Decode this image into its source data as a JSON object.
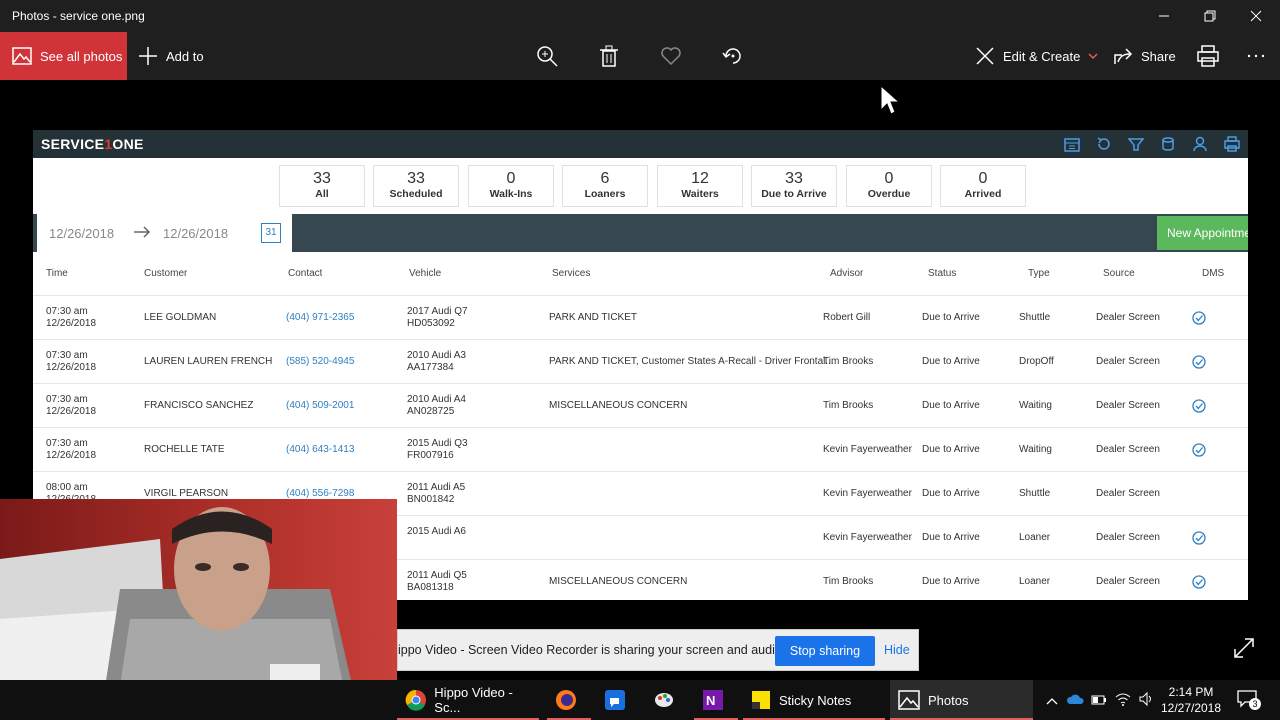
{
  "window": {
    "title": "Photos - service one.png"
  },
  "toolbar": {
    "see_all": "See all photos",
    "add_to": "Add to",
    "edit_create": "Edit & Create",
    "share": "Share"
  },
  "app": {
    "logo_a": "SERVICE",
    "logo_b": "1",
    "logo_c": "ONE",
    "stats": [
      {
        "num": "33",
        "label": "All"
      },
      {
        "num": "33",
        "label": "Scheduled"
      },
      {
        "num": "0",
        "label": "Walk-Ins"
      },
      {
        "num": "6",
        "label": "Loaners"
      },
      {
        "num": "12",
        "label": "Waiters"
      },
      {
        "num": "33",
        "label": "Due to Arrive"
      },
      {
        "num": "0",
        "label": "Overdue"
      },
      {
        "num": "0",
        "label": "Arrived"
      }
    ],
    "date_from": "12/26/2018",
    "date_to": "12/26/2018",
    "calendar_day": "31",
    "new_appt": "New Appointme",
    "columns": [
      "Time",
      "Customer",
      "Contact",
      "Vehicle",
      "Services",
      "Advisor",
      "Status",
      "Type",
      "Source",
      "DMS"
    ],
    "rows": [
      {
        "time": "07:30 am",
        "date": "12/26/2018",
        "customer": "LEE GOLDMAN",
        "contact": "(404) 971-2365",
        "vehicle": "2017 Audi Q7",
        "vin": "HD053092",
        "services": "PARK AND TICKET",
        "advisor": "Robert Gill",
        "status": "Due to Arrive",
        "type": "Shuttle",
        "source": "Dealer Screen"
      },
      {
        "time": "07:30 am",
        "date": "12/26/2018",
        "customer": "LAUREN LAUREN FRENCH",
        "contact": "(585) 520-4945",
        "vehicle": "2010 Audi A3",
        "vin": "AA177384",
        "services": "PARK AND TICKET, Customer States A-Recall - Driver Frontal...",
        "advisor": "Tim Brooks",
        "status": "Due to Arrive",
        "type": "DropOff",
        "source": "Dealer Screen"
      },
      {
        "time": "07:30 am",
        "date": "12/26/2018",
        "customer": "FRANCISCO SANCHEZ",
        "contact": "(404) 509-2001",
        "vehicle": "2010 Audi A4",
        "vin": "AN028725",
        "services": "MISCELLANEOUS CONCERN",
        "advisor": "Tim Brooks",
        "status": "Due to Arrive",
        "type": "Waiting",
        "source": "Dealer Screen"
      },
      {
        "time": "07:30 am",
        "date": "12/26/2018",
        "customer": "ROCHELLE TATE",
        "contact": "(404) 643-1413",
        "vehicle": "2015 Audi Q3",
        "vin": "FR007916",
        "services": "",
        "advisor": "Kevin Fayerweather",
        "status": "Due to Arrive",
        "type": "Waiting",
        "source": "Dealer Screen"
      },
      {
        "time": "08:00 am",
        "date": "12/26/2018",
        "customer": "VIRGIL PEARSON",
        "contact": "(404) 556-7298",
        "vehicle": "2011 Audi A5",
        "vin": "BN001842",
        "services": "",
        "advisor": "Kevin Fayerweather",
        "status": "Due to Arrive",
        "type": "Shuttle",
        "source": "Dealer Screen"
      },
      {
        "time": "",
        "date": "",
        "customer": "",
        "contact": "",
        "vehicle": "2015 Audi A6",
        "vin": "",
        "services": "",
        "advisor": "Kevin Fayerweather",
        "status": "Due to Arrive",
        "type": "Loaner",
        "source": "Dealer Screen"
      },
      {
        "time": "",
        "date": "",
        "customer": "",
        "contact": "",
        "vehicle": "2011 Audi Q5",
        "vin": "BA081318",
        "services": "MISCELLANEOUS CONCERN",
        "advisor": "Tim Brooks",
        "status": "Due to Arrive",
        "type": "Loaner",
        "source": "Dealer Screen"
      }
    ]
  },
  "share_bar": {
    "message": "ippo Video - Screen Video Recorder is sharing your screen and audio.",
    "stop": "Stop sharing",
    "hide": "Hide"
  },
  "taskbar": {
    "chrome_label": "Hippo Video - Sc...",
    "sticky_label": "Sticky Notes",
    "photos_label": "Photos",
    "time": "2:14 PM",
    "date": "12/27/2018",
    "notif_count": "3"
  }
}
